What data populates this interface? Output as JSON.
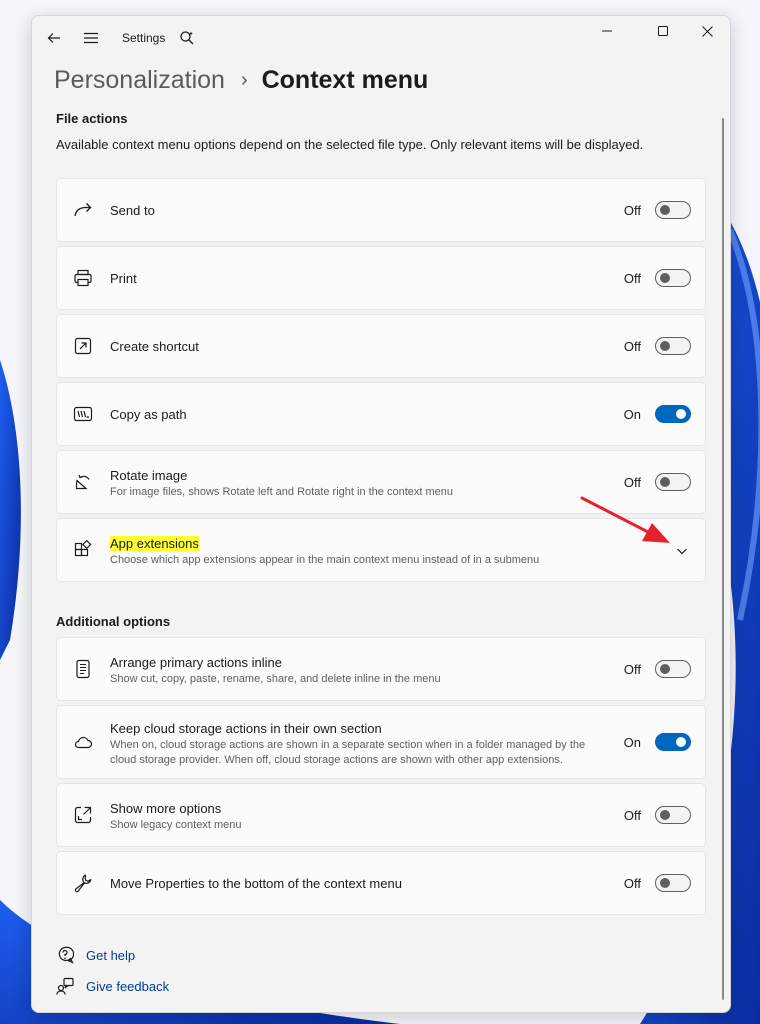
{
  "window": {
    "app_title": "Settings"
  },
  "breadcrumb": {
    "parent": "Personalization",
    "separator": "›",
    "current": "Context menu"
  },
  "file_actions": {
    "title": "File actions",
    "description": "Available context menu options depend on the selected file type. Only relevant items will be displayed.",
    "items": [
      {
        "label": "Send to",
        "state": "Off",
        "on": false,
        "icon": "share-arrow-icon"
      },
      {
        "label": "Print",
        "state": "Off",
        "on": false,
        "icon": "printer-icon"
      },
      {
        "label": "Create shortcut",
        "state": "Off",
        "on": false,
        "icon": "shortcut-icon"
      },
      {
        "label": "Copy as path",
        "state": "On",
        "on": true,
        "icon": "copy-path-icon"
      },
      {
        "label": "Rotate image",
        "sub": "For image files, shows Rotate left and Rotate right in the context menu",
        "state": "Off",
        "on": false,
        "icon": "rotate-icon"
      },
      {
        "label": "App extensions",
        "sub": "Choose which app extensions appear in the main context menu instead of in a submenu",
        "icon": "apps-icon"
      }
    ]
  },
  "additional_options": {
    "title": "Additional options",
    "items": [
      {
        "label": "Arrange primary actions inline",
        "sub": "Show cut, copy, paste, rename, share, and delete inline in the menu",
        "state": "Off",
        "on": false,
        "icon": "list-icon"
      },
      {
        "label": "Keep cloud storage actions in their own section",
        "sub": "When on, cloud storage actions are shown in a separate section when in a folder managed by the cloud storage provider. When off, cloud storage actions are shown with other app extensions.",
        "state": "On",
        "on": true,
        "icon": "cloud-icon"
      },
      {
        "label": "Show more options",
        "sub": "Show legacy context menu",
        "state": "Off",
        "on": false,
        "icon": "expand-icon"
      },
      {
        "label": "Move Properties to the bottom of the context menu",
        "state": "Off",
        "on": false,
        "icon": "wrench-icon"
      }
    ]
  },
  "links": {
    "help": "Get help",
    "feedback": "Give feedback"
  },
  "colors": {
    "accent": "#0067c0",
    "highlight": "#ffff33",
    "annotation_arrow": "#e8202a",
    "link": "#003e92"
  }
}
